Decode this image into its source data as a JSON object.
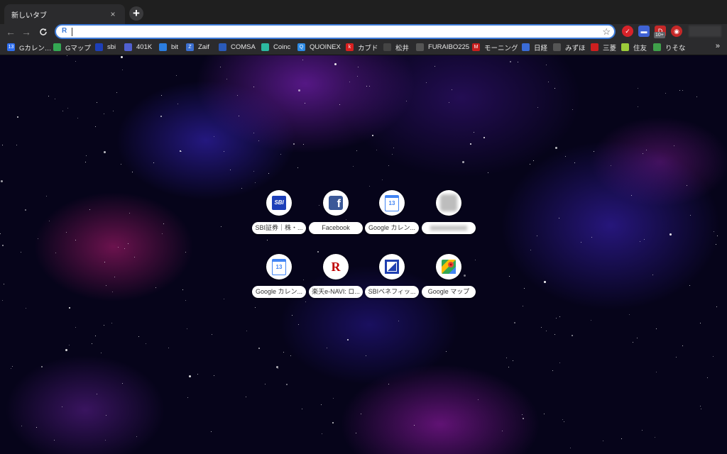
{
  "tab": {
    "title": "新しいタブ",
    "close_glyph": "×"
  },
  "toolbar": {
    "back_glyph": "←",
    "forward_glyph": "→",
    "reload_glyph": "C",
    "omnibox_icon": "R",
    "omnibox_value": "",
    "star_glyph": "☆",
    "new_tab_glyph": "+",
    "ext_badge": "10+"
  },
  "bookmarks": [
    {
      "label": "Gカレン…",
      "icon": "calendar-icon",
      "color": "#2f6ff0",
      "glyph": "13"
    },
    {
      "label": "Gマップ",
      "icon": "maps-icon",
      "color": "#34a853",
      "glyph": ""
    },
    {
      "label": "sbi",
      "icon": "sbi-icon",
      "color": "#1d3fb8",
      "glyph": ""
    },
    {
      "label": "401K",
      "icon": "401k-icon",
      "color": "#5060d0",
      "glyph": ""
    },
    {
      "label": "bit",
      "icon": "bitflyer-icon",
      "color": "#2b7de0",
      "glyph": ""
    },
    {
      "label": "Zaif",
      "icon": "zaif-icon",
      "color": "#3b6fd0",
      "glyph": "Z"
    },
    {
      "label": "COMSA",
      "icon": "comsa-icon",
      "color": "#2a5ab8",
      "glyph": ""
    },
    {
      "label": "Coinc",
      "icon": "coincheck-icon",
      "color": "#2cb8a0",
      "glyph": ""
    },
    {
      "label": "QUOINEX",
      "icon": "quoinex-icon",
      "color": "#2d8be6",
      "glyph": "Q"
    },
    {
      "label": "カブド",
      "icon": "kabudot-icon",
      "color": "#d82020",
      "glyph": "k"
    },
    {
      "label": "松井",
      "icon": "matsui-icon",
      "color": "#444444",
      "glyph": ""
    },
    {
      "label": "FURAIBO225",
      "icon": "page-icon",
      "color": "#555555",
      "glyph": ""
    },
    {
      "label": "モーニング",
      "icon": "morning-icon",
      "color": "#c81e1e",
      "glyph": "M"
    },
    {
      "label": "日経",
      "icon": "nikkei-icon",
      "color": "#3a6bd6",
      "glyph": ""
    },
    {
      "label": "みずほ",
      "icon": "page-icon",
      "color": "#555555",
      "glyph": ""
    },
    {
      "label": "三菱",
      "icon": "mufg-icon",
      "color": "#cc1f1f",
      "glyph": ""
    },
    {
      "label": "住友",
      "icon": "smbc-icon",
      "color": "#9ccc3a",
      "glyph": ""
    },
    {
      "label": "りそな",
      "icon": "resona-icon",
      "color": "#3fa04a",
      "glyph": ""
    }
  ],
  "bookmarks_more": "»",
  "shortcuts": [
    {
      "label": "SBI証券｜株・...",
      "icon": "sbi-icon"
    },
    {
      "label": "Facebook",
      "icon": "facebook-icon"
    },
    {
      "label": "Google カレン...",
      "icon": "calendar-icon"
    },
    {
      "label": "",
      "icon": "blurred-site-icon"
    },
    {
      "label": "Google カレン...",
      "icon": "calendar-icon"
    },
    {
      "label": "楽天e-NAVI: ロ...",
      "icon": "rakuten-icon"
    },
    {
      "label": "SBIベネフィッ...",
      "icon": "sbi-benefit-icon"
    },
    {
      "label": "Google マップ",
      "icon": "maps-icon"
    }
  ],
  "icon_texts": {
    "sbi": "SBI",
    "facebook": "f",
    "calendar": "13",
    "rakuten": "R"
  },
  "colors": {
    "accent": "#3d7bd9",
    "tab_bg": "#2b2b2d",
    "strip_bg": "#1f1f1f",
    "background": "#06041a"
  }
}
